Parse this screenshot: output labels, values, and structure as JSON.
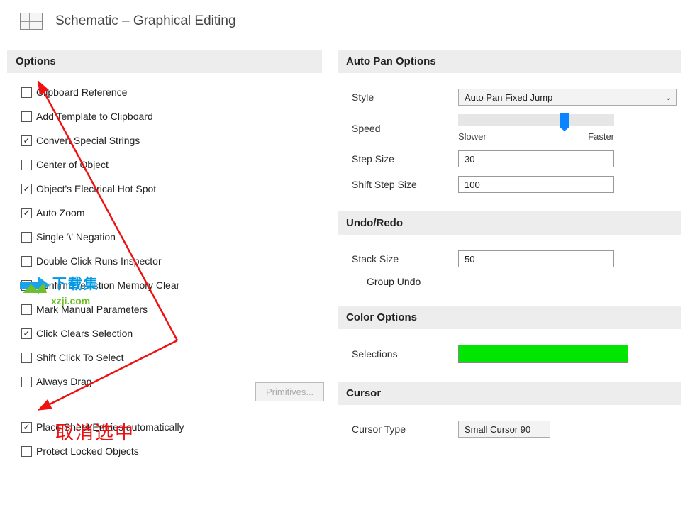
{
  "header": {
    "title": "Schematic – Graphical Editing"
  },
  "left": {
    "section_title": "Options",
    "checkboxes": [
      {
        "label": "Clipboard Reference",
        "checked": false
      },
      {
        "label": "Add Template to Clipboard",
        "checked": false
      },
      {
        "label": "Convert Special Strings",
        "checked": true
      },
      {
        "label": "Center of Object",
        "checked": false
      },
      {
        "label": "Object's Electrical Hot Spot",
        "checked": true
      },
      {
        "label": "Auto Zoom",
        "checked": true
      },
      {
        "label": "Single '\\' Negation",
        "checked": false
      },
      {
        "label": "Double Click Runs Inspector",
        "checked": false
      },
      {
        "label": "Confirm Selection Memory Clear",
        "checked": false
      },
      {
        "label": "Mark Manual Parameters",
        "checked": false
      },
      {
        "label": "Click Clears Selection",
        "checked": true
      },
      {
        "label": "Shift Click To Select",
        "checked": false
      },
      {
        "label": "Always Drag",
        "checked": false
      },
      {
        "label": "Place Sheet Entries automatically",
        "checked": true
      },
      {
        "label": "Protect Locked Objects",
        "checked": false
      }
    ],
    "primitives_button": "Primitives..."
  },
  "autopan": {
    "section_title": "Auto Pan Options",
    "style_label": "Style",
    "style_value": "Auto Pan Fixed Jump",
    "speed_label": "Speed",
    "speed_slower": "Slower",
    "speed_faster": "Faster",
    "speed_value_pct": 65,
    "step_size_label": "Step Size",
    "step_size_value": "30",
    "shift_step_label": "Shift Step Size",
    "shift_step_value": "100"
  },
  "undo": {
    "section_title": "Undo/Redo",
    "stack_label": "Stack Size",
    "stack_value": "50",
    "group_undo_label": "Group Undo",
    "group_undo_checked": false
  },
  "color": {
    "section_title": "Color Options",
    "selections_label": "Selections",
    "selections_color": "#00e600"
  },
  "cursor": {
    "section_title": "Cursor",
    "type_label": "Cursor Type",
    "type_value": "Small Cursor 90"
  },
  "annotation": {
    "text": "取消选中"
  },
  "watermark": {
    "line1": "下载集",
    "line2": "xzji.com"
  }
}
